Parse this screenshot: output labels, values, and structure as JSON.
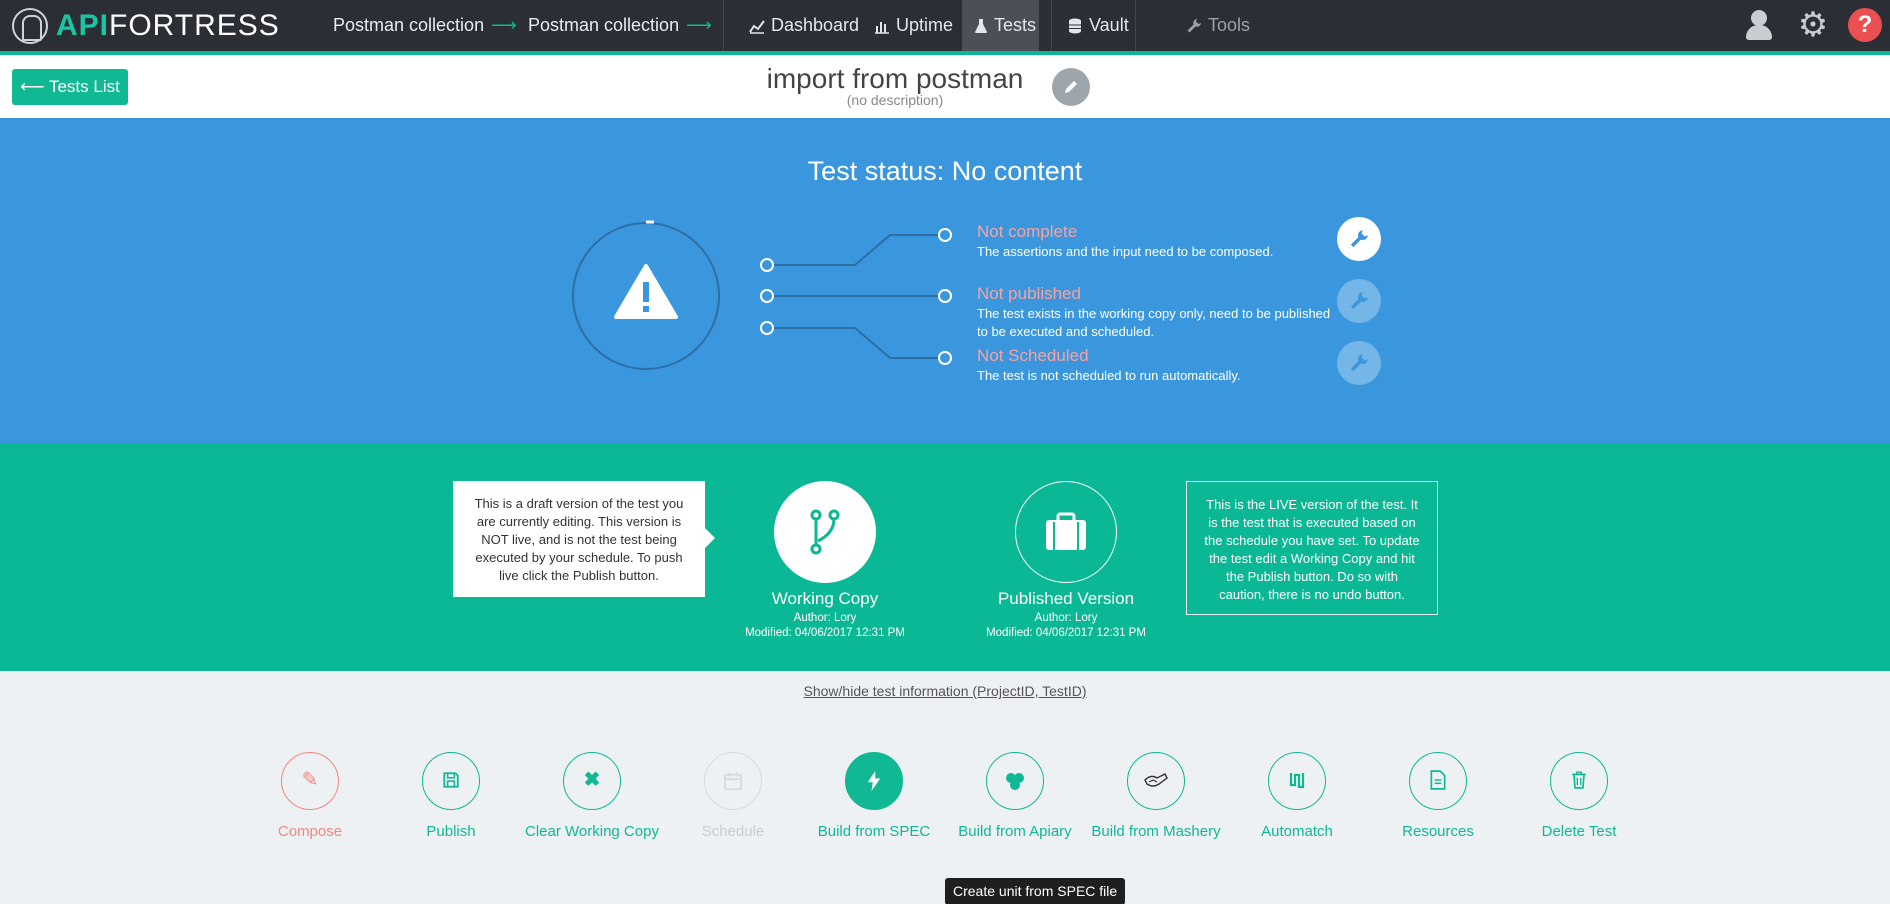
{
  "nav": {
    "logo_left": "API",
    "logo_right": "FORTRESS",
    "breadcrumbs": [
      "Postman collection",
      "Postman collection"
    ],
    "arrow": "⟶",
    "items": [
      {
        "label": "Dashboard",
        "icon": "line-chart-icon"
      },
      {
        "label": "Uptime",
        "icon": "bar-chart-icon"
      },
      {
        "label": "Tests",
        "icon": "flask-icon"
      },
      {
        "label": "Vault",
        "icon": "database-icon"
      },
      {
        "label": "Tools",
        "icon": "wrench-icon"
      }
    ],
    "active": "Tests",
    "help_glyph": "?"
  },
  "header": {
    "back_label": "Tests List",
    "title": "import from postman",
    "description": "(no description)"
  },
  "status": {
    "title": "Test status: No content",
    "states": [
      {
        "label": "Not complete",
        "text": "The assertions and the input need to be composed.",
        "active": true
      },
      {
        "label": "Not published",
        "text": "The test exists in the working copy only, need to be published to be executed and scheduled.",
        "active": false
      },
      {
        "label": "Not Scheduled",
        "text": "The test is not scheduled to run automatically.",
        "active": false
      }
    ]
  },
  "versions": {
    "draft_tip": "This is a draft version of the test you are currently editing. This version is NOT live, and is not the test being executed by your schedule. To push live click the Publish button.",
    "live_tip": "This is the LIVE version of the test. It is the test that is executed based on the schedule you have set. To update the test edit a Working Copy and hit the Publish button. Do so with caution, there is no undo button.",
    "working": {
      "name": "Working Copy",
      "author": "Author: Lory",
      "modified": "Modified: 04/06/2017 12:31 PM"
    },
    "published": {
      "name": "Published Version",
      "author": "Author: Lory",
      "modified": "Modified: 04/06/2017 12:31 PM"
    }
  },
  "show_hide": "Show/hide test information (ProjectID, TestID)",
  "actions": [
    {
      "label": "Compose",
      "icon": "pencil-icon",
      "state": "warning"
    },
    {
      "label": "Publish",
      "icon": "save-icon",
      "state": "normal"
    },
    {
      "label": "Clear Working Copy",
      "icon": "close-icon",
      "state": "normal"
    },
    {
      "label": "Schedule",
      "icon": "calendar-icon",
      "state": "disabled"
    },
    {
      "label": "Build from SPEC",
      "icon": "bolt-icon",
      "state": "filled"
    },
    {
      "label": "Build from Apiary",
      "icon": "apiary-icon",
      "state": "normal"
    },
    {
      "label": "Build from Mashery",
      "icon": "mashery-icon",
      "state": "normal"
    },
    {
      "label": "Automatch",
      "icon": "automatch-icon",
      "state": "normal"
    },
    {
      "label": "Resources",
      "icon": "document-icon",
      "state": "normal"
    },
    {
      "label": "Delete Test",
      "icon": "trash-icon",
      "state": "normal"
    }
  ],
  "tooltip": "Create unit from SPEC file",
  "colors": {
    "nav": "#2b2e35",
    "accent": "#0ab896",
    "status_bg": "#3a97dd",
    "warning": "#f1887b",
    "state_label": "#f7a2a0"
  }
}
